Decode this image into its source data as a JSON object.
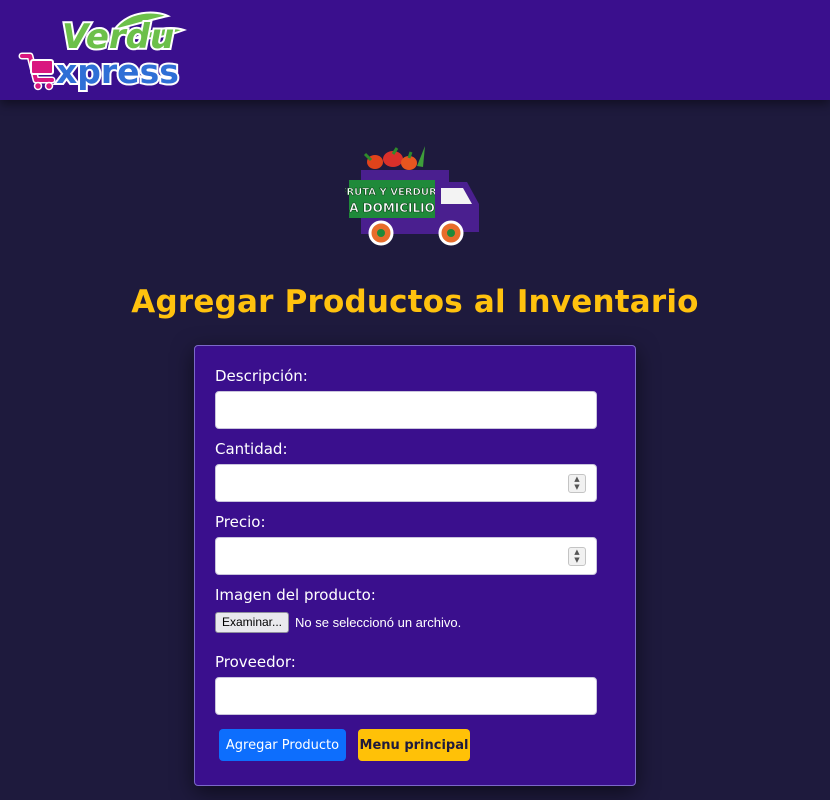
{
  "header": {
    "logo_top": "Verdu",
    "logo_bottom": "xpress",
    "colors": {
      "bar": "#3a0f8d",
      "green": "#6cc04a",
      "magenta": "#d9177f",
      "blue": "#2f6fd6"
    }
  },
  "hero": {
    "truck_sign_line1": "FRUTA Y VERDURA",
    "truck_sign_line2": "A DOMICILIO",
    "icon": "delivery-truck-icon"
  },
  "page": {
    "title": "Agregar Productos al Inventario"
  },
  "form": {
    "fields": {
      "description": {
        "label": "Descripción:",
        "value": ""
      },
      "quantity": {
        "label": "Cantidad:",
        "value": ""
      },
      "price": {
        "label": "Precio:",
        "value": ""
      },
      "image": {
        "label": "Imagen del producto:",
        "button": "Examinar...",
        "status": "No se seleccionó un archivo."
      },
      "provider": {
        "label": "Proveedor:",
        "value": ""
      }
    },
    "buttons": {
      "submit": "Agregar Producto",
      "menu": "Menu principal"
    }
  },
  "colors": {
    "background": "#1e1a3d",
    "card": "#3a0f8d",
    "title": "#ffc20e",
    "primary": "#0d6efd",
    "warning": "#ffc107"
  }
}
